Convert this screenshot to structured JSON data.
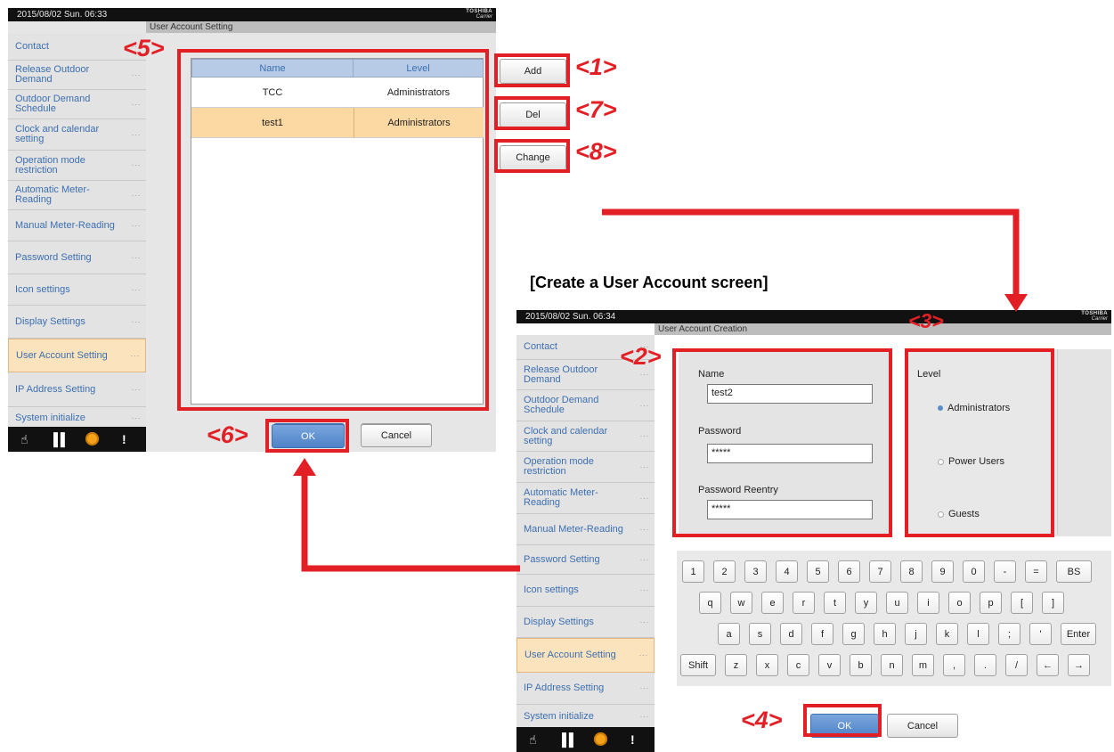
{
  "left_screen": {
    "datetime": "2015/08/02 Sun. 06:33",
    "brand_top": "TOSHIBA",
    "brand_bottom": "Carrier",
    "subtitle": "User Account Setting",
    "sidebar": [
      {
        "label": "Contact"
      },
      {
        "label": "Release Outdoor Demand"
      },
      {
        "label": "Outdoor Demand Schedule"
      },
      {
        "label": "Clock and calendar setting"
      },
      {
        "label": "Operation mode restriction"
      },
      {
        "label": "Automatic Meter-Reading"
      },
      {
        "label": "Manual Meter-Reading"
      },
      {
        "label": "Password Setting"
      },
      {
        "label": "Icon settings"
      },
      {
        "label": "Display Settings"
      },
      {
        "label": "User Account Setting",
        "active": true
      },
      {
        "label": "IP Address Setting"
      },
      {
        "label": "System initialize"
      }
    ],
    "sidebar_more": "···",
    "table": {
      "headers": [
        "Name",
        "Level"
      ],
      "rows": [
        {
          "name": "TCC",
          "level": "Administrators",
          "selected": false
        },
        {
          "name": "test1",
          "level": "Administrators",
          "selected": true
        }
      ]
    },
    "buttons": {
      "add": "Add",
      "del": "Del",
      "change": "Change",
      "ok": "OK",
      "cancel": "Cancel"
    }
  },
  "right_screen": {
    "heading": "[Create a User Account screen]",
    "datetime": "2015/08/02 Sun. 06:34",
    "brand_top": "TOSHIBA",
    "brand_bottom": "Carrier",
    "subtitle": "User Account Creation",
    "form": {
      "name_label": "Name",
      "name_value": "test2",
      "password_label": "Password",
      "password_value": "*****",
      "reentry_label": "Password Reentry",
      "reentry_value": "*****"
    },
    "level": {
      "title": "Level",
      "options": [
        "Administrators",
        "Power Users",
        "Guests"
      ],
      "selected": "Administrators"
    },
    "keyboard": {
      "row1": [
        "1",
        "2",
        "3",
        "4",
        "5",
        "6",
        "7",
        "8",
        "9",
        "0",
        "-",
        "=",
        "BS"
      ],
      "row2": [
        "q",
        "w",
        "e",
        "r",
        "t",
        "y",
        "u",
        "i",
        "o",
        "p",
        "[",
        "]"
      ],
      "row3": [
        "a",
        "s",
        "d",
        "f",
        "g",
        "h",
        "j",
        "k",
        "l",
        ";",
        "'",
        "Enter"
      ],
      "row4": [
        "Shift",
        "z",
        "x",
        "c",
        "v",
        "b",
        "n",
        "m",
        ",",
        ".",
        "/",
        "←",
        "→"
      ]
    },
    "buttons": {
      "ok": "OK",
      "cancel": "Cancel"
    }
  },
  "annotations": {
    "a1": "<1>",
    "a2": "<2>",
    "a3": "<3>",
    "a4": "<4>",
    "a5": "<5>",
    "a6": "<6>",
    "a7": "<7>",
    "a8": "<8>"
  },
  "colors": {
    "annotation_red": "#e31f26",
    "sidebar_text": "#3d6fb0",
    "selected_row": "#fcd9a3"
  }
}
